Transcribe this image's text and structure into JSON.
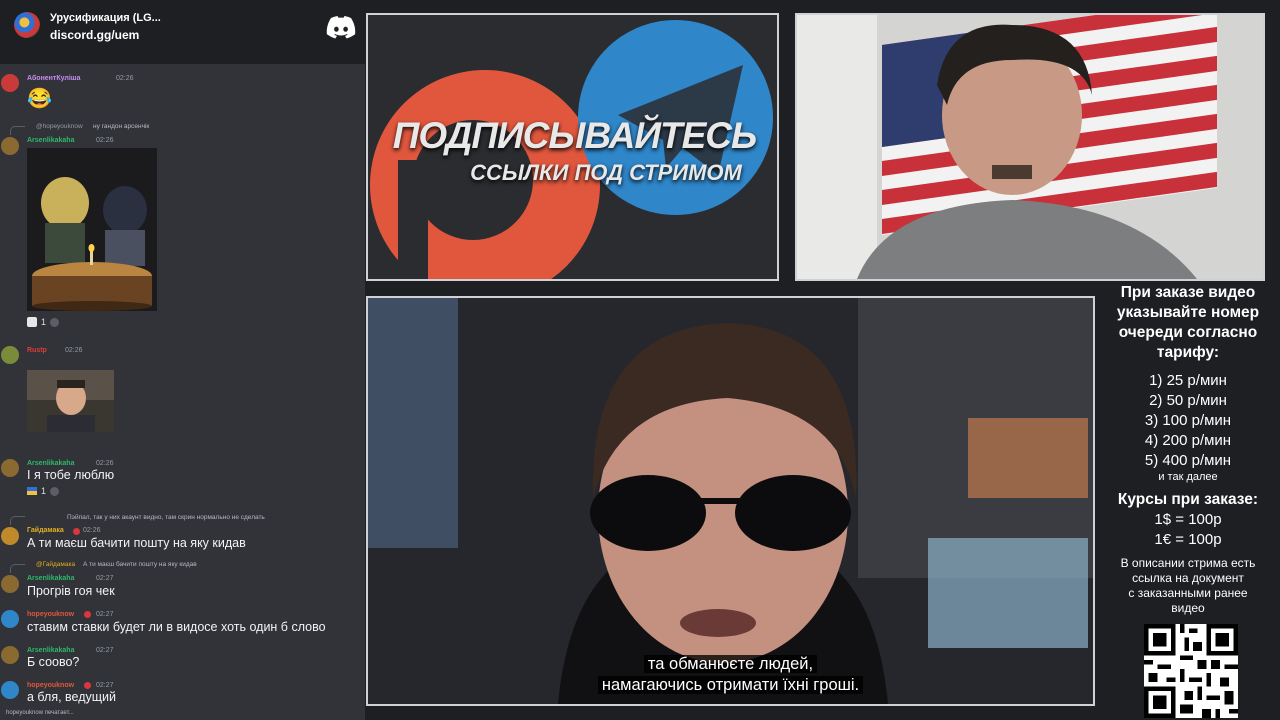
{
  "discord": {
    "server_name": "Урусификация (LG...",
    "invite": "discord.gg/uem",
    "typing": "hopeyouknow печатает...",
    "messages": [
      {
        "author": "АбонентКуліша",
        "author_color": "#c48df0",
        "time": "02:26",
        "text": "😂"
      },
      {
        "reply_author": "@hopeyouknow",
        "reply_text": "ну гандон арсенчік",
        "author": "Arsenlikakaha",
        "author_color": "#2eb86a",
        "time": "02:26",
        "reaction_count": "1"
      },
      {
        "author": "Rustp",
        "author_color": "#e03a3a",
        "time": "02:26"
      },
      {
        "author": "Arsenlikakaha",
        "author_color": "#2eb86a",
        "time": "02:26",
        "text": "І я тобе люблю",
        "reaction_count": "1"
      },
      {
        "reply_text": "Пэйпал, так у них акаунт видно, там скрин нормально не сделать",
        "author": "Гайдамака",
        "author_color": "#e0b020",
        "time": "02:26",
        "text": "А ти маєш бачити пошту на яку кидав"
      },
      {
        "reply_author": "@Гайдамака",
        "reply_text": "А ти маєш бачити пошту на яку кидав",
        "author": "Arsenlikakaha",
        "author_color": "#2eb86a",
        "time": "02:27",
        "text": "Прогрів гоя чек"
      },
      {
        "author": "hopeyouknow",
        "author_color": "#e0573d",
        "time": "02:27",
        "text": "ставим ставки будет ли в видосе хоть один б слово"
      },
      {
        "author": "Arsenlikakaha",
        "author_color": "#2eb86a",
        "time": "02:27",
        "text": "Б соово?"
      },
      {
        "author": "hopeyouknow",
        "author_color": "#e0573d",
        "time": "02:27",
        "text": "а бля, ведущий"
      }
    ]
  },
  "promo": {
    "title": "ПОДПИСЫВАЙТЕСЬ",
    "subtitle": "ССЫЛКИ ПОД СТРИМОМ"
  },
  "video": {
    "subtitle_line1": "та обманюєте людей,",
    "subtitle_line2": "намагаючись отримати їхні гроші."
  },
  "info": {
    "heading_line1": "При заказе видео",
    "heading_line2": "указывайте номер",
    "heading_line3": "очереди согласно",
    "heading_line4": "тарифу:",
    "tariffs": [
      "1) 25 р/мин",
      "2) 50 р/мин",
      "3) 100 р/мин",
      "4) 200 р/мин",
      "5) 400 р/мин"
    ],
    "and_so_on": "и так далее",
    "rates_heading": "Курсы при заказе:",
    "rate_usd": "1$ = 100р",
    "rate_eur": "1€ = 100р",
    "desc_line1": "В описании стрима есть",
    "desc_line2": "ссылка на документ",
    "desc_line3": "с заказанными ранее",
    "desc_line4": "видео"
  }
}
